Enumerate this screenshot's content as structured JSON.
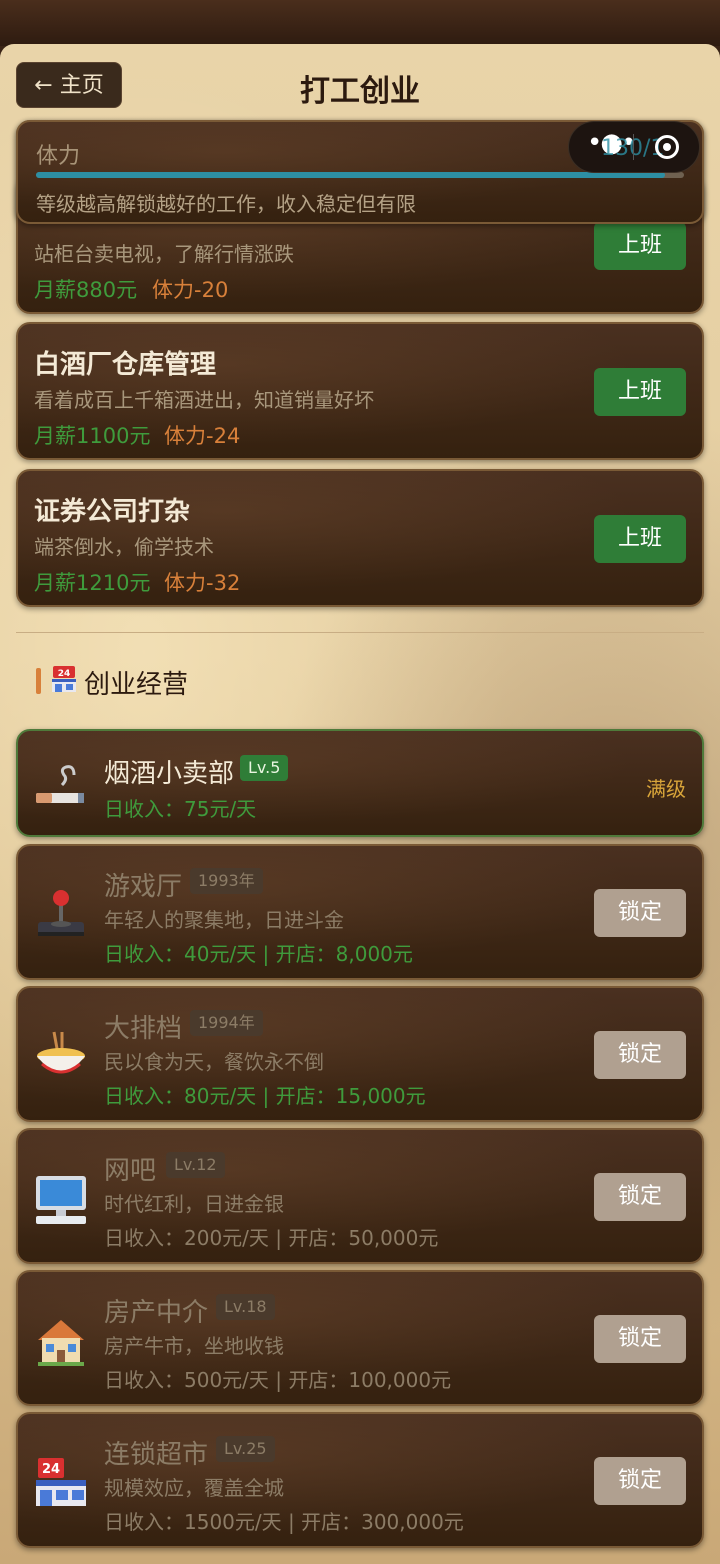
{
  "header": {
    "back_label": "← 主页",
    "title": "打工创业"
  },
  "stamina": {
    "label": "体力",
    "value_text": "130/1",
    "level": 0.97,
    "hint": "等级越高解锁越好的工作，收入稳定但有限"
  },
  "jobs": [
    {
      "title": "",
      "desc": "站柜台卖电视，了解行情涨跌",
      "salary": "月薪880元",
      "cost": "体力-20",
      "button": "上班"
    },
    {
      "title": "白酒厂仓库管理",
      "desc": "看着成百上千箱酒进出，知道销量好坏",
      "salary": "月薪1100元",
      "cost": "体力-24",
      "button": "上班"
    },
    {
      "title": "证券公司打杂",
      "desc": "端茶倒水，偷学技术",
      "salary": "月薪1210元",
      "cost": "体力-32",
      "button": "上班"
    }
  ],
  "business_section": {
    "title": "创业经营"
  },
  "businesses": [
    {
      "icon": "cigarette-icon",
      "name": "烟酒小卖部",
      "badge": "Lv.5",
      "desc": "",
      "income": "日收入：75元/天",
      "status": "满级"
    },
    {
      "icon": "joystick-icon",
      "name": "游戏厅",
      "badge": "1993年",
      "desc": "年轻人的聚集地，日进斗金",
      "income": "日收入：40元/天 | 开店：8,000元",
      "button": "锁定"
    },
    {
      "icon": "noodle-bowl-icon",
      "name": "大排档",
      "badge": "1994年",
      "desc": "民以食为天，餐饮永不倒",
      "income": "日收入：80元/天 | 开店：15,000元",
      "button": "锁定"
    },
    {
      "icon": "computer-icon",
      "name": "网吧",
      "badge": "Lv.12",
      "desc": "时代红利，日进金银",
      "income": "日收入：200元/天 | 开店：50,000元",
      "button": "锁定"
    },
    {
      "icon": "house-icon",
      "name": "房产中介",
      "badge": "Lv.18",
      "desc": "房产牛市，坐地收钱",
      "income": "日收入：500元/天 | 开店：100,000元",
      "button": "锁定"
    },
    {
      "icon": "convenience-store-icon",
      "name": "连锁超市",
      "badge": "Lv.25",
      "desc": "规模效应，覆盖全城",
      "income": "日收入：1500元/天 | 开店：300,000元",
      "button": "锁定"
    }
  ],
  "colors": {
    "work_button": "#2f7d37",
    "salary_green": "#3f9b3c",
    "cost_orange": "#d8803a",
    "lock_button": "#b0a090",
    "stamina_bar": "#2d8fa3",
    "max_level_gold": "#d9a53a"
  }
}
